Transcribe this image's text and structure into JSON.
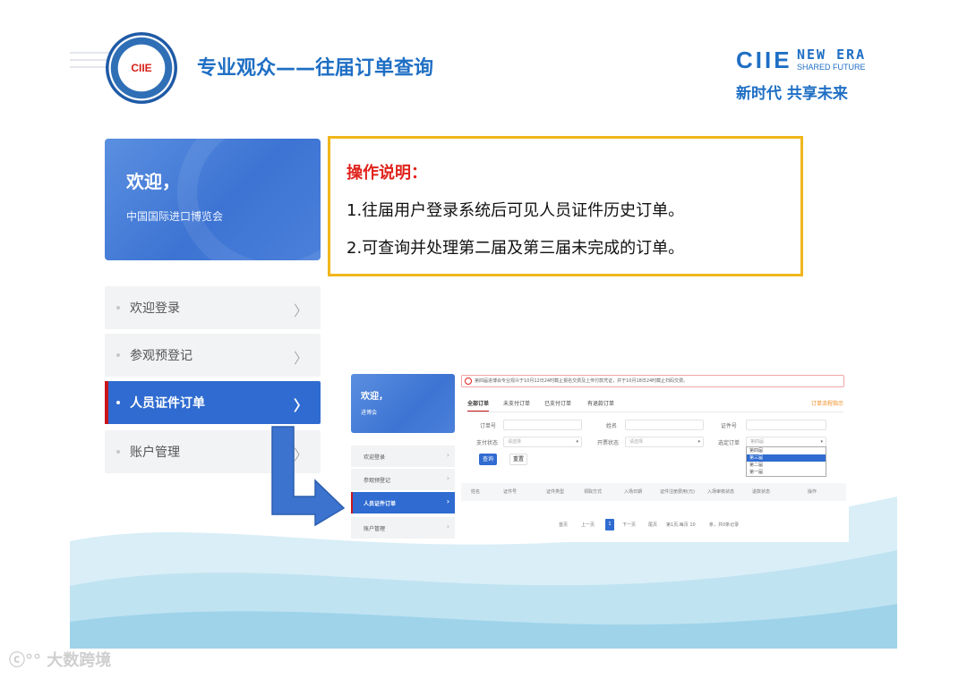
{
  "header": {
    "logo_text": "CIIE",
    "title": "专业观众——往届订单查询",
    "brand_ciie": "CIIE",
    "brand_new_era": "NEW ERA",
    "brand_shared": "SHARED FUTURE",
    "brand_cn": "新时代 共享未来"
  },
  "sidebar": {
    "welcome_title": "欢迎，",
    "welcome_sub": "中国国际进口博览会",
    "items": [
      {
        "label": "欢迎登录"
      },
      {
        "label": "参观预登记"
      },
      {
        "label": "人员证件订单"
      },
      {
        "label": "账户管理"
      }
    ]
  },
  "instructions": {
    "heading": "操作说明：",
    "line1": "1.往届用户登录系统后可见人员证件历史订单。",
    "line2": "2.可查询并处理第二届及第三届未完成的订单。"
  },
  "mini": {
    "welcome_title": "欢迎，",
    "welcome_sub": "进博会",
    "side_items": [
      "欢迎登录",
      "参观预登记",
      "人员证件订单",
      "账户管理"
    ],
    "notice": "第四届进博会专业观众于10月12日24时截止报名交费及上传付款凭证，并于10月18日24时截止扫码交费。",
    "tabs": [
      "全部订单",
      "未支付订单",
      "已支付订单",
      "有退款订单"
    ],
    "tab_right": "订单流程指示",
    "labels": {
      "order_no": "订单号",
      "name": "姓名",
      "cert_no": "证件号",
      "pay_status": "支付状态",
      "open_status": "开票状态",
      "session_order": "选定订单"
    },
    "select_placeholder": "请选择",
    "session_value": "第四届",
    "dropdown": [
      "第四届",
      "第三届",
      "第二届",
      "第一届"
    ],
    "buttons": {
      "search": "查询",
      "reset": "重置"
    },
    "table_headers": [
      "姓名",
      "证件号",
      "证件类型",
      "领取方式",
      "入场日期",
      "证件注册费用(元)",
      "入场审核状态",
      "退款状态",
      "操作"
    ],
    "pager": {
      "first": "首页",
      "prev": "上一页",
      "current": "1",
      "next": "下一页",
      "last": "尾页",
      "page_info": "第1页,每页 10",
      "total": "条，共0条记录"
    }
  },
  "watermark": "大数跨境",
  "colors": {
    "brand_blue": "#1f6fc4",
    "active_blue": "#2f6bd0",
    "accent_red": "#e0231c",
    "box_yellow": "#f0b61b"
  }
}
